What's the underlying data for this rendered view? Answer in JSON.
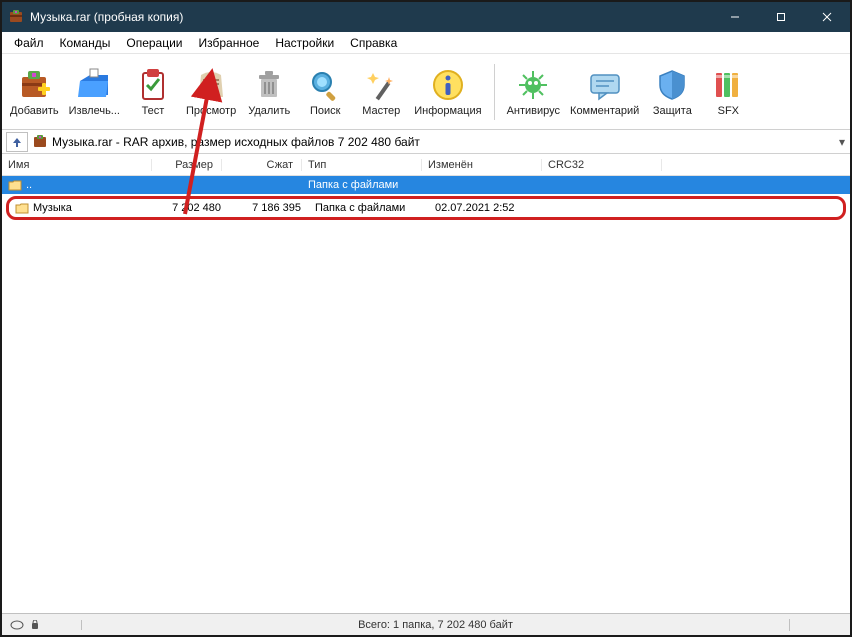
{
  "titlebar": {
    "title": "Музыка.rar (пробная копия)"
  },
  "menu": {
    "file": "Файл",
    "commands": "Команды",
    "operations": "Операции",
    "favorites": "Избранное",
    "settings": "Настройки",
    "help": "Справка"
  },
  "toolbar": {
    "add": "Добавить",
    "extract": "Извлечь...",
    "test": "Тест",
    "view": "Просмотр",
    "delete": "Удалить",
    "find": "Поиск",
    "wizard": "Мастер",
    "info": "Информация",
    "antivirus": "Антивирус",
    "comment": "Комментарий",
    "protect": "Защита",
    "sfx": "SFX"
  },
  "pathbar": {
    "path": "Музыка.rar - RAR архив, размер исходных файлов 7 202 480 байт"
  },
  "columns": {
    "name": "Имя",
    "size": "Размер",
    "packed": "Сжат",
    "type": "Тип",
    "modified": "Изменён",
    "crc32": "CRC32"
  },
  "rows": {
    "parent": {
      "name": "..",
      "type": "Папка с файлами"
    },
    "item0": {
      "name": "Музыка",
      "size": "7 202 480",
      "packed": "7 186 395",
      "type": "Папка с файлами",
      "modified": "02.07.2021 2:52",
      "crc32": ""
    }
  },
  "statusbar": {
    "total": "Всего: 1 папка, 7 202 480 байт"
  }
}
